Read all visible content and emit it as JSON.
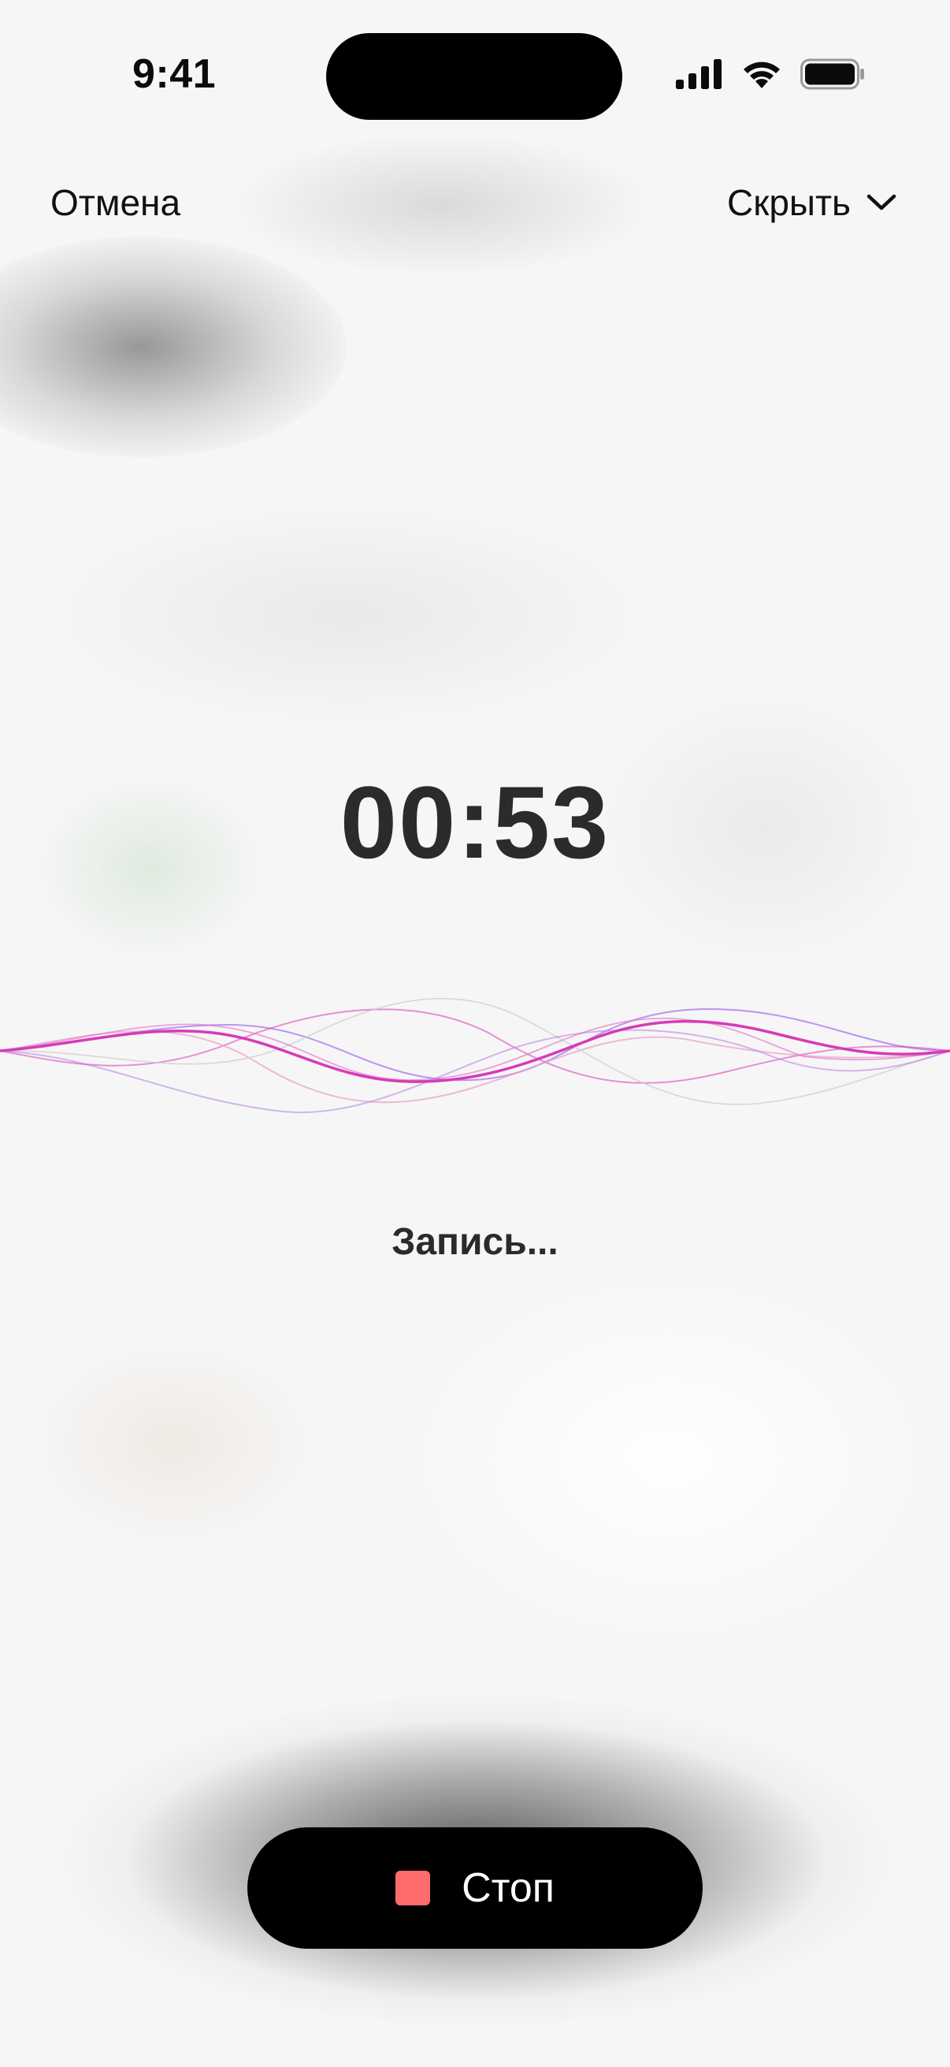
{
  "status_bar": {
    "time": "9:41"
  },
  "nav": {
    "cancel_label": "Отмена",
    "hide_label": "Скрыть"
  },
  "recorder": {
    "elapsed": "00:53",
    "status_text": "Запись..."
  },
  "stop_button": {
    "label": "Стоп",
    "icon_color": "#ff6b6b"
  },
  "colors": {
    "wave_primary": "#d63bb8",
    "wave_secondary": "#a26bf0",
    "wave_tertiary": "#e8a0c8"
  }
}
